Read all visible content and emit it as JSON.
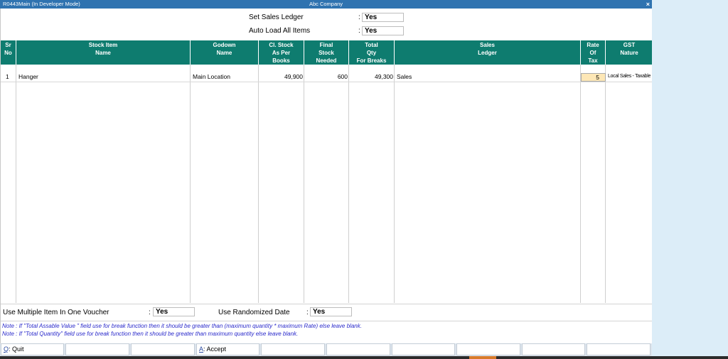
{
  "window": {
    "title_left": "R0443Main (In Developer Mode)",
    "title_center": "Abc Company",
    "close_glyph": "×"
  },
  "header_fields": [
    {
      "label": "Set Sales Ledger",
      "colon": ":",
      "value": "Yes"
    },
    {
      "label": "Auto Load All Items",
      "colon": ":",
      "value": "Yes"
    }
  ],
  "table": {
    "header_color": "#0e7c6f",
    "columns": [
      {
        "line1": "Sr",
        "line2": "No",
        "line3": ""
      },
      {
        "line1": "Stock Item",
        "line2": "Name",
        "line3": ""
      },
      {
        "line1": "Godown",
        "line2": "Name",
        "line3": ""
      },
      {
        "line1": "Cl. Stock",
        "line2": "As Per",
        "line3": "Books"
      },
      {
        "line1": "Final",
        "line2": "Stock",
        "line3": "Needed"
      },
      {
        "line1": "Total",
        "line2": "Qty",
        "line3": "For Breaks"
      },
      {
        "line1": "Sales",
        "line2": "Ledger",
        "line3": ""
      },
      {
        "line1": "Rate",
        "line2": "Of",
        "line3": "Tax"
      },
      {
        "line1": "GST",
        "line2": "Nature",
        "line3": ""
      }
    ],
    "rows": [
      {
        "sr_no": "1",
        "stock_item": "Hanger",
        "godown": "Main Location",
        "cl_stock": "49,900",
        "final_stock": "600",
        "total_qty": "49,300",
        "sales_ledger": "Sales",
        "rate_of_tax": "5",
        "gst_nature": "Local Sales - Taxable"
      }
    ]
  },
  "bottom_fields": [
    {
      "label": "Use Multiple Item In One Voucher",
      "colon": ":",
      "value": "Yes"
    },
    {
      "label": "Use Randomized Date",
      "colon": ":",
      "value": "Yes"
    }
  ],
  "notes": [
    "Note : If \"Total Assable Value \" field use for break function then it should be greater than (maximum quantity * maximum Rate) else leave blank.",
    "Note : If \"Total Quantity\" field use for break function then it should be greater than maximum quantity else leave blank."
  ],
  "buttons": [
    {
      "key": "Q",
      "label": ": Quit"
    },
    {
      "key": "",
      "label": ""
    },
    {
      "key": "",
      "label": ""
    },
    {
      "key": "A",
      "label": ": Accept"
    },
    {
      "key": "",
      "label": ""
    },
    {
      "key": "",
      "label": ""
    },
    {
      "key": "",
      "label": ""
    },
    {
      "key": "",
      "label": ""
    },
    {
      "key": "",
      "label": ""
    },
    {
      "key": "",
      "label": ""
    }
  ]
}
